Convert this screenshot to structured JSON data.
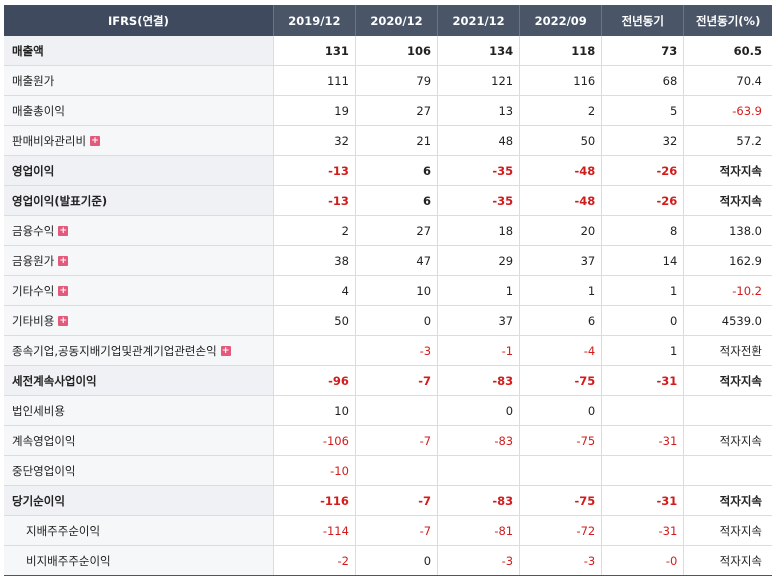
{
  "table": {
    "headers": [
      "IFRS(연결)",
      "2019/12",
      "2020/12",
      "2021/12",
      "2022/09",
      "전년동기",
      "전년동기(%)"
    ],
    "rows": [
      {
        "label": "매출액",
        "bold": true,
        "sub": false,
        "expand": false,
        "values": [
          "131",
          "106",
          "134",
          "118",
          "73",
          "60.5"
        ]
      },
      {
        "label": "매출원가",
        "bold": false,
        "sub": false,
        "expand": false,
        "values": [
          "111",
          "79",
          "121",
          "116",
          "68",
          "70.4"
        ]
      },
      {
        "label": "매출총이익",
        "bold": false,
        "sub": false,
        "expand": false,
        "values": [
          "19",
          "27",
          "13",
          "2",
          "5",
          "-63.9"
        ]
      },
      {
        "label": "판매비와관리비",
        "bold": false,
        "sub": false,
        "expand": true,
        "values": [
          "32",
          "21",
          "48",
          "50",
          "32",
          "57.2"
        ]
      },
      {
        "label": "영업이익",
        "bold": true,
        "sub": false,
        "expand": false,
        "values": [
          "-13",
          "6",
          "-35",
          "-48",
          "-26",
          "적자지속"
        ]
      },
      {
        "label": "영업이익(발표기준)",
        "bold": true,
        "sub": false,
        "expand": false,
        "values": [
          "-13",
          "6",
          "-35",
          "-48",
          "-26",
          "적자지속"
        ]
      },
      {
        "label": "금융수익",
        "bold": false,
        "sub": false,
        "expand": true,
        "values": [
          "2",
          "27",
          "18",
          "20",
          "8",
          "138.0"
        ]
      },
      {
        "label": "금융원가",
        "bold": false,
        "sub": false,
        "expand": true,
        "values": [
          "38",
          "47",
          "29",
          "37",
          "14",
          "162.9"
        ]
      },
      {
        "label": "기타수익",
        "bold": false,
        "sub": false,
        "expand": true,
        "values": [
          "4",
          "10",
          "1",
          "1",
          "1",
          "-10.2"
        ]
      },
      {
        "label": "기타비용",
        "bold": false,
        "sub": false,
        "expand": true,
        "values": [
          "50",
          "0",
          "37",
          "6",
          "0",
          "4539.0"
        ]
      },
      {
        "label": "종속기업,공동지배기업및관계기업관련손익",
        "bold": false,
        "sub": false,
        "expand": true,
        "values": [
          "",
          "-3",
          "-1",
          "-4",
          "1",
          "적자전환"
        ]
      },
      {
        "label": "세전계속사업이익",
        "bold": true,
        "sub": false,
        "expand": false,
        "values": [
          "-96",
          "-7",
          "-83",
          "-75",
          "-31",
          "적자지속"
        ]
      },
      {
        "label": "법인세비용",
        "bold": false,
        "sub": false,
        "expand": false,
        "values": [
          "10",
          "",
          "0",
          "0",
          "",
          ""
        ]
      },
      {
        "label": "계속영업이익",
        "bold": false,
        "sub": false,
        "expand": false,
        "values": [
          "-106",
          "-7",
          "-83",
          "-75",
          "-31",
          "적자지속"
        ]
      },
      {
        "label": "중단영업이익",
        "bold": false,
        "sub": false,
        "expand": false,
        "values": [
          "-10",
          "",
          "",
          "",
          "",
          ""
        ]
      },
      {
        "label": "당기순이익",
        "bold": true,
        "sub": false,
        "expand": false,
        "values": [
          "-116",
          "-7",
          "-83",
          "-75",
          "-31",
          "적자지속"
        ]
      },
      {
        "label": "지배주주순이익",
        "bold": false,
        "sub": true,
        "expand": false,
        "values": [
          "-114",
          "-7",
          "-81",
          "-72",
          "-31",
          "적자지속"
        ]
      },
      {
        "label": "비지배주주순이익",
        "bold": false,
        "sub": true,
        "expand": false,
        "values": [
          "-2",
          "0",
          "-3",
          "-3",
          "-0",
          "적자지속"
        ]
      }
    ]
  },
  "expand_icon": {
    "name": "plus-icon",
    "glyph": "+"
  },
  "colors": {
    "header_bg": "#4a5568",
    "negative": "#d21c1c"
  }
}
